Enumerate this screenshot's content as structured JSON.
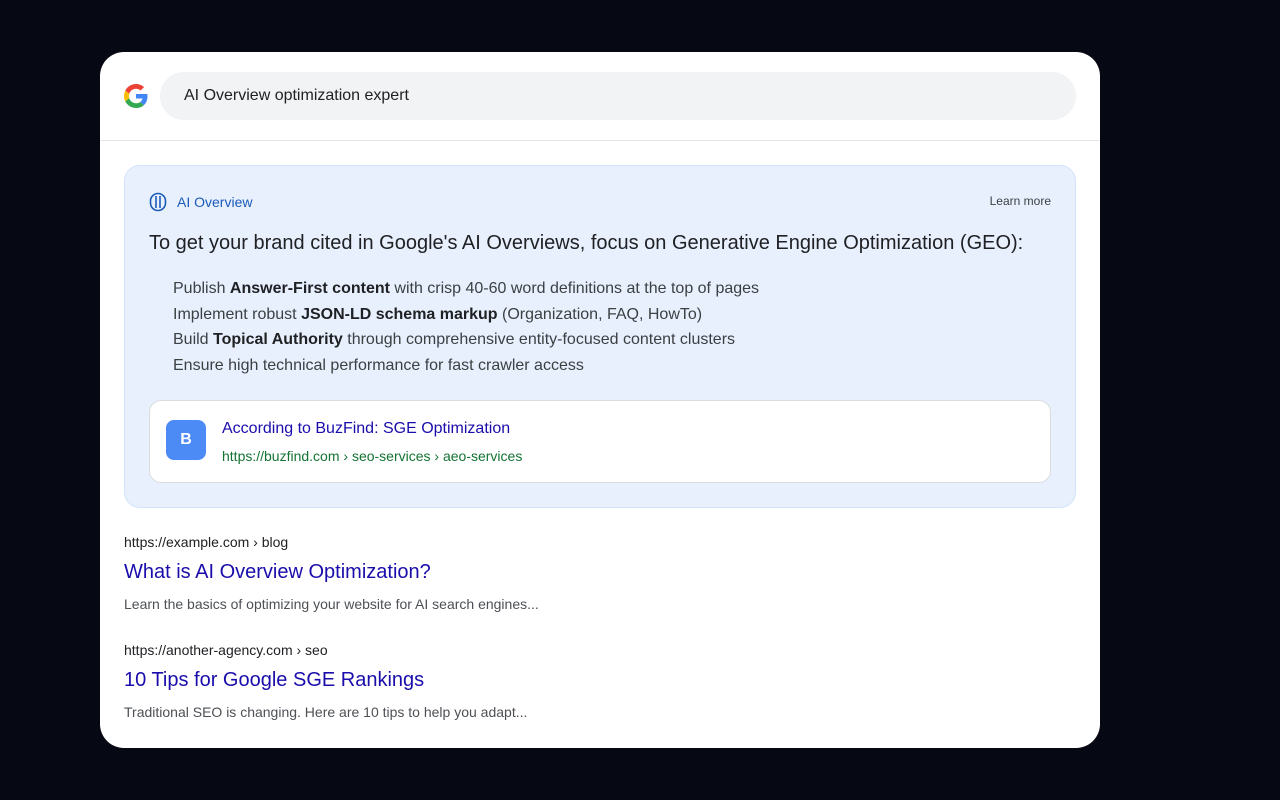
{
  "search": {
    "query": "AI Overview optimization expert"
  },
  "ai_overview": {
    "label": "AI Overview",
    "learn_more": "Learn more",
    "summary": "To get your brand cited in Google's AI Overviews, focus on Generative Engine Optimization (GEO):",
    "items": [
      {
        "pre": "Publish ",
        "bold": "Answer-First content",
        "post": " with crisp 40-60 word definitions at the top of pages"
      },
      {
        "pre": "Implement robust ",
        "bold": "JSON-LD schema markup",
        "post": " (Organization, FAQ, HowTo)"
      },
      {
        "pre": "Build ",
        "bold": "Topical Authority",
        "post": " through comprehensive entity-focused content clusters"
      },
      {
        "pre": "Ensure high technical performance for fast crawler access",
        "bold": "",
        "post": ""
      }
    ],
    "source": {
      "badge": "B",
      "title": "According to BuzFind: SGE Optimization",
      "url": "https://buzfind.com › seo-services › aeo-services"
    }
  },
  "results": [
    {
      "url": "https://example.com › blog",
      "title": "What is AI Overview Optimization?",
      "snippet": "Learn the basics of optimizing your website for AI search engines..."
    },
    {
      "url": "https://another-agency.com › seo",
      "title": "10 Tips for Google SGE Rankings",
      "snippet": "Traditional SEO is changing. Here are 10 tips to help you adapt..."
    }
  ],
  "colors": {
    "background": "#060914",
    "ai_panel": "#e8f0fe",
    "link": "#1a0dab",
    "url_green": "#137333",
    "badge_blue": "#4c8bf5"
  }
}
